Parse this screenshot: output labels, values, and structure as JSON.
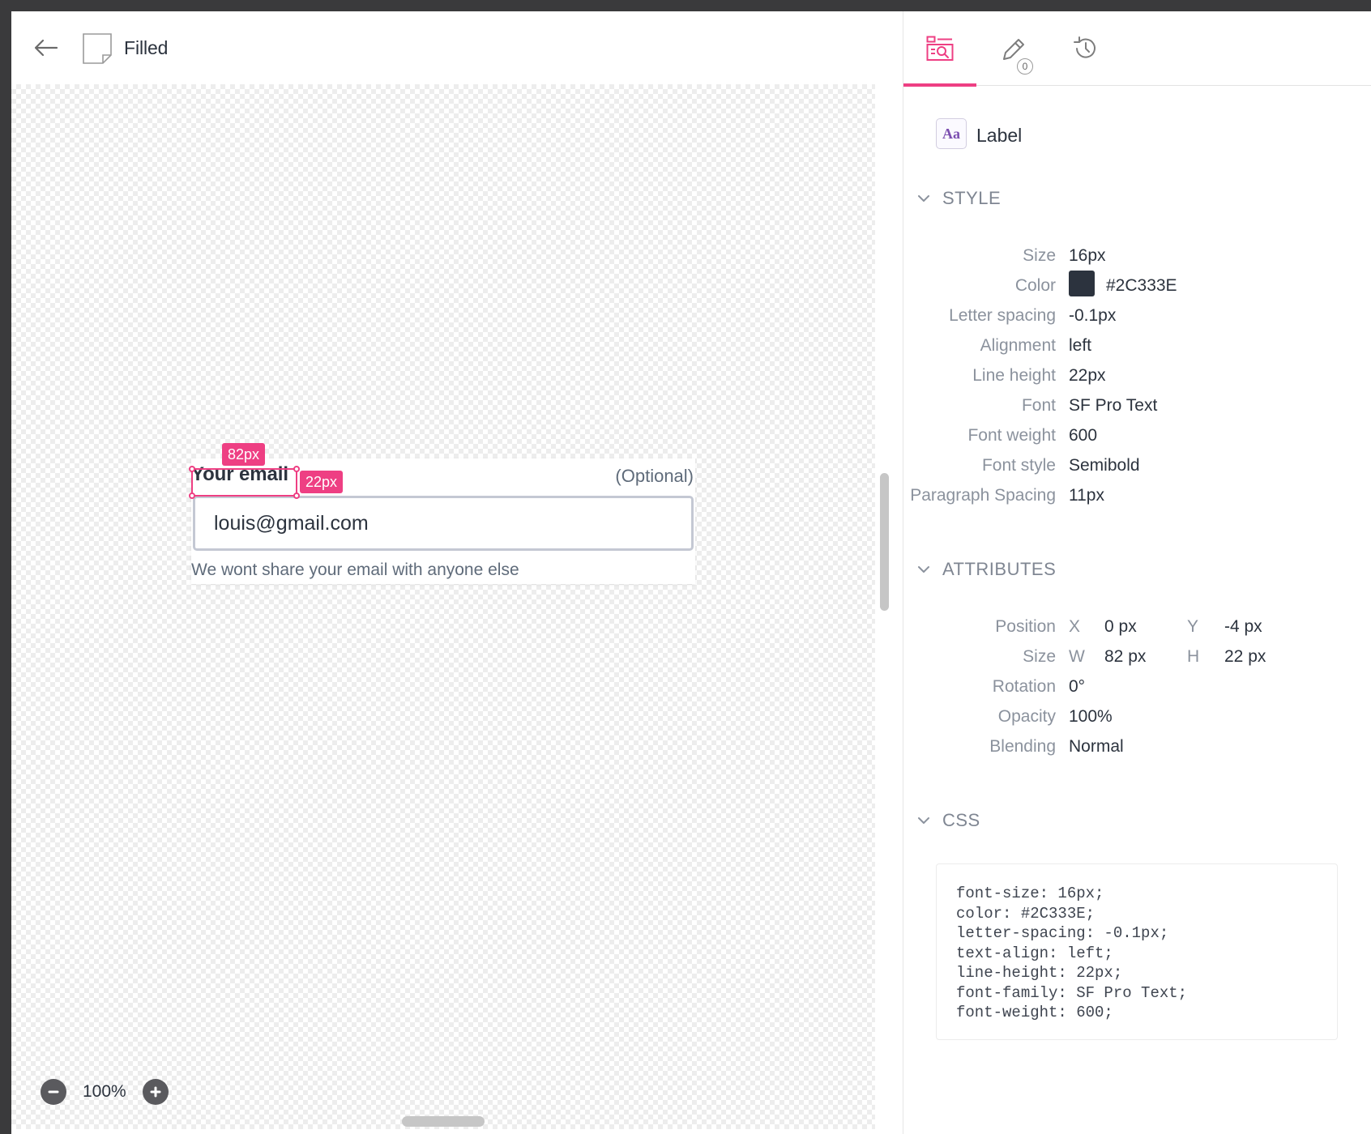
{
  "document": {
    "title": "Filled"
  },
  "component": {
    "label": "Your email",
    "optional": "(Optional)",
    "input_value": "louis@gmail.com",
    "help_text": "We wont share your email with anyone else"
  },
  "selection": {
    "width_badge": "82px",
    "height_badge": "22px"
  },
  "zoom": {
    "level": "100%"
  },
  "panel": {
    "tabs": [
      {
        "name": "inspect",
        "icon": "inspect-icon"
      },
      {
        "name": "comments",
        "icon": "pencil-icon",
        "badge": "0"
      },
      {
        "name": "history",
        "icon": "history-icon"
      }
    ],
    "layer": {
      "icon_text": "Aa",
      "name": "Label"
    },
    "style": {
      "heading": "STYLE",
      "rows": [
        {
          "label": "Size",
          "value": "16px"
        },
        {
          "label": "Color",
          "value": "#2C333E",
          "swatch": "#2C333E"
        },
        {
          "label": "Letter spacing",
          "value": "-0.1px"
        },
        {
          "label": "Alignment",
          "value": "left"
        },
        {
          "label": "Line height",
          "value": "22px"
        },
        {
          "label": "Font",
          "value": "SF Pro Text"
        },
        {
          "label": "Font weight",
          "value": "600"
        },
        {
          "label": "Font style",
          "value": "Semibold"
        },
        {
          "label": "Paragraph Spacing",
          "value": "11px"
        }
      ]
    },
    "attributes": {
      "heading": "ATTRIBUTES",
      "position": {
        "label": "Position",
        "x_key": "X",
        "x": "0 px",
        "y_key": "Y",
        "y": "-4 px"
      },
      "size": {
        "label": "Size",
        "w_key": "W",
        "w": "82 px",
        "h_key": "H",
        "h": "22 px"
      },
      "rows": [
        {
          "label": "Rotation",
          "value": "0°"
        },
        {
          "label": "Opacity",
          "value": "100%"
        },
        {
          "label": "Blending",
          "value": "Normal"
        }
      ]
    },
    "css": {
      "heading": "CSS",
      "lines": [
        "font-size: 16px;",
        "color: #2C333E;",
        "letter-spacing: -0.1px;",
        "text-align: left;",
        "line-height: 22px;",
        "font-family: SF Pro Text;",
        "font-weight: 600;"
      ]
    }
  },
  "colors": {
    "accent": "#EE3F83",
    "text": "#2C333E",
    "muted": "#8B929D"
  }
}
